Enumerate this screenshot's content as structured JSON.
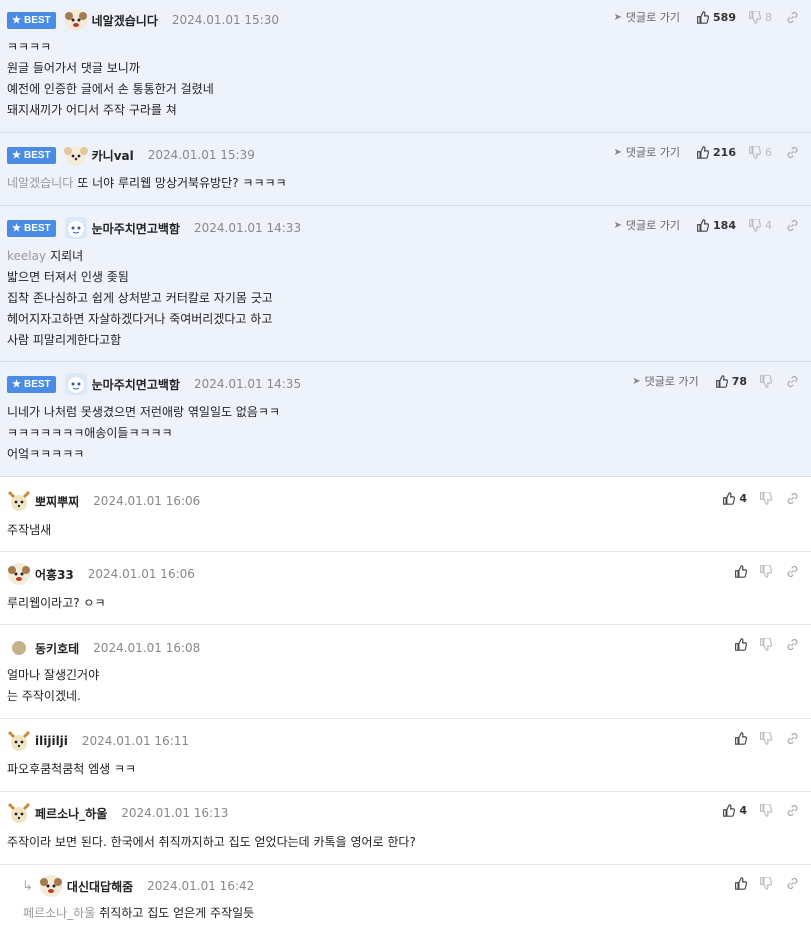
{
  "badge_label": "BEST",
  "goto_label": "댓글로 가기",
  "comments": [
    {
      "nick": "네알겠습니다",
      "time": "2024.01.01 15:30",
      "likes": "589",
      "dislikes": "8",
      "lines": [
        "ㅋㅋㅋㅋ",
        "원글 들어가서 댓글 보니까",
        "예전에 인증한 글에서 손 통통한거 걸렸네",
        "돼지새끼가 어디서 주작 구라를 쳐"
      ]
    },
    {
      "nick": "카니val",
      "time": "2024.01.01 15:39",
      "likes": "216",
      "dislikes": "6",
      "mention": "네알겠습니다",
      "lines": [
        "또 너야 루리웹 망상거북유방단? ㅋㅋㅋㅋ"
      ]
    },
    {
      "nick": "눈마주치면고백함",
      "time": "2024.01.01 14:33",
      "likes": "184",
      "dislikes": "4",
      "mention": "keelay",
      "lines": [
        "지뢰녀",
        "밟으면 터져서 인생 좆됨",
        "집착 존나심하고 쉽게 상처받고 커터칼로 자기몸 긋고",
        "헤어지자고하면 자살하겠다거나 죽여버리겠다고 하고",
        "사람 피말리게한다고함"
      ]
    },
    {
      "nick": "눈마주치면고백함",
      "time": "2024.01.01 14:35",
      "likes": "78",
      "lines": [
        "니네가 나처럼 못생겼으면 저런애랑 엮일일도 없음ㅋㅋ",
        "ㅋㅋㅋㅋㅋㅋㅋ애송이들ㅋㅋㅋㅋ",
        "어엌ㅋㅋㅋㅋㅋ"
      ]
    },
    {
      "nick": "뽀찌뿌찌",
      "time": "2024.01.01 16:06",
      "likes": "4",
      "lines": [
        "주작냄새"
      ]
    },
    {
      "nick": "어흥33",
      "time": "2024.01.01 16:06",
      "lines": [
        "루리웹이라고? ㅇㅋ"
      ]
    },
    {
      "nick": "동키호테",
      "time": "2024.01.01 16:08",
      "lines": [
        "얼마나 잘생긴거야",
        "는 주작이겠네."
      ]
    },
    {
      "nick": "ilijilji",
      "time": "2024.01.01 16:11",
      "lines": [
        "파오후쿰척쿰척 엠생 ㅋㅋ"
      ]
    },
    {
      "nick": "페르소나_하울",
      "time": "2024.01.01 16:13",
      "likes": "4",
      "lines": [
        "주작이라 보면 된다. 한국에서 취직까지하고 집도 얻었다는데 카톡을 영어로 한다?"
      ]
    },
    {
      "nick": "대신대답해줌",
      "time": "2024.01.01 16:42",
      "mention": "페르소나_하울",
      "lines": [
        "취직하고 집도 얻은게 주작일듯"
      ]
    }
  ],
  "colors": {
    "best_badge": "#4a8be5",
    "best_bg": "#eef3fb",
    "text": "#222222",
    "muted": "#888888"
  }
}
